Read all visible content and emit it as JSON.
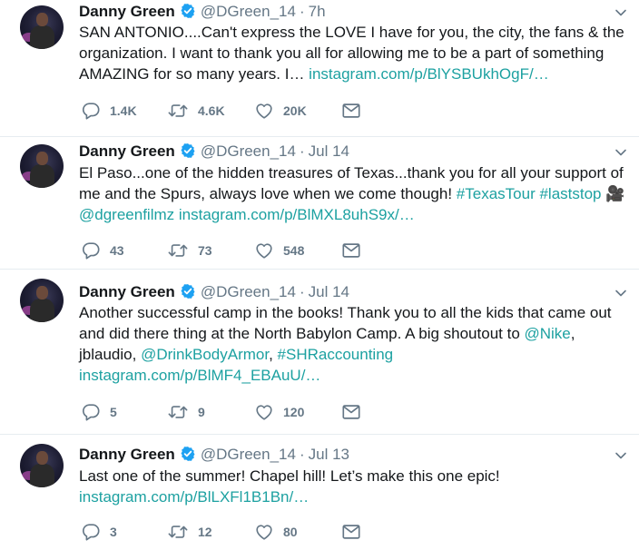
{
  "tweets": [
    {
      "name": "Danny Green",
      "handle": "@DGreen_14",
      "time": "7h",
      "text": [
        {
          "t": "SAN ANTONIO....Can't express the LOVE I have for you, the city, the fans & the organization. I want to thank you all for allowing me to be a part of something AMAZING for so many years. I… ",
          "style": "plain"
        },
        {
          "t": "instagram.com/p/BlYSBUkhOgF/…",
          "style": "link"
        }
      ],
      "replies": "1.4K",
      "retweets": "4.6K",
      "likes": "20K"
    },
    {
      "name": "Danny Green",
      "handle": "@DGreen_14",
      "time": "Jul 14",
      "text": [
        {
          "t": "El Paso...one of the hidden treasures of Texas...thank you for all your support of me and the Spurs, always love when we come though! ",
          "style": "plain"
        },
        {
          "t": "#TexasTour",
          "style": "link"
        },
        {
          "t": " ",
          "style": "plain"
        },
        {
          "t": "#laststop",
          "style": "link"
        },
        {
          "t": " 🎥 ",
          "style": "plain"
        },
        {
          "t": "@dgreenfilmz",
          "style": "link"
        },
        {
          "t": " ",
          "style": "plain"
        },
        {
          "t": "instagram.com/p/BlMXL8uhS9x/…",
          "style": "link"
        }
      ],
      "replies": "43",
      "retweets": "73",
      "likes": "548"
    },
    {
      "name": "Danny Green",
      "handle": "@DGreen_14",
      "time": "Jul 14",
      "text": [
        {
          "t": "Another successful camp in the books! Thank you to all the kids that came out and did there thing at the North Babylon Camp. A big shoutout to ",
          "style": "plain"
        },
        {
          "t": "@Nike",
          "style": "link"
        },
        {
          "t": ", jblaudio, ",
          "style": "plain"
        },
        {
          "t": "@DrinkBodyArmor",
          "style": "link"
        },
        {
          "t": ", ",
          "style": "plain"
        },
        {
          "t": "#SHRaccounting",
          "style": "link"
        },
        {
          "t": " ",
          "style": "plain"
        },
        {
          "t": "instagram.com/p/BlMF4_EBAuU/…",
          "style": "link"
        }
      ],
      "replies": "5",
      "retweets": "9",
      "likes": "120"
    },
    {
      "name": "Danny Green",
      "handle": "@DGreen_14",
      "time": "Jul 13",
      "text": [
        {
          "t": "Last one of the summer! Chapel hill! Let’s make this one epic! ",
          "style": "plain"
        },
        {
          "t": "instagram.com/p/BlLXFl1B1Bn/…",
          "style": "link"
        }
      ],
      "replies": "3",
      "retweets": "12",
      "likes": "80"
    }
  ],
  "icons": {
    "verified": "verified-badge-icon",
    "caret": "chevron-down-icon",
    "reply": "reply-icon",
    "retweet": "retweet-icon",
    "like": "heart-icon",
    "dm": "envelope-icon"
  },
  "colors": {
    "link": "#1da1a1",
    "verified": "#1da1f2",
    "muted": "#657786",
    "divider": "#e6ecf0"
  }
}
